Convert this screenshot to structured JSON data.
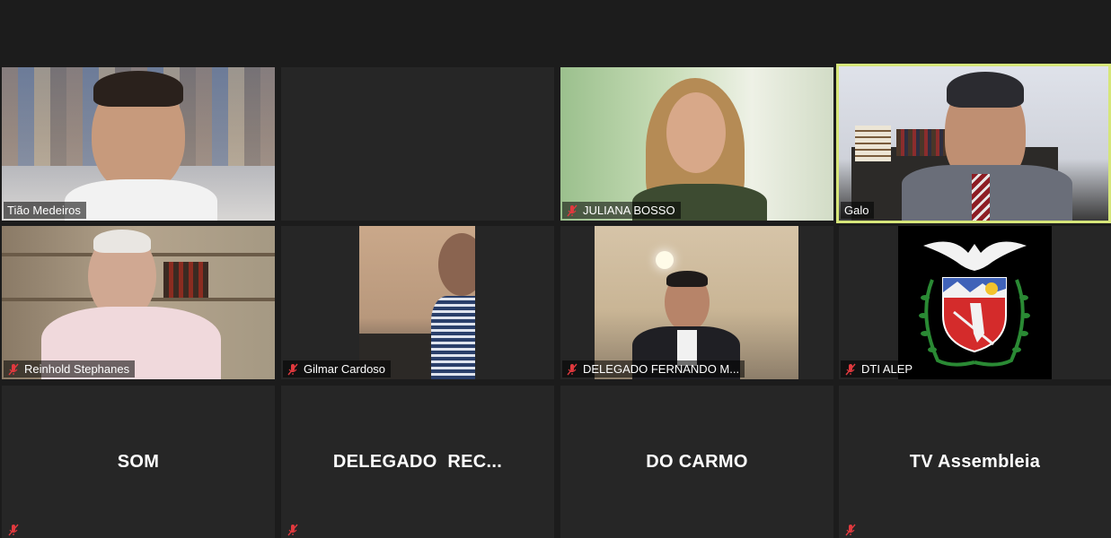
{
  "participants": [
    {
      "name": "Tião Medeiros",
      "muted": false,
      "video": true
    },
    {
      "name": "",
      "muted": false,
      "video": false
    },
    {
      "name": "JULIANA BOSSO",
      "muted": true,
      "video": true
    },
    {
      "name": "Galo",
      "muted": false,
      "video": true,
      "active_speaker": true
    },
    {
      "name": "Reinhold Stephanes",
      "muted": true,
      "video": true
    },
    {
      "name": "Gilmar Cardoso",
      "muted": true,
      "video": true
    },
    {
      "name": "DELEGADO FERNANDO M...",
      "muted": true,
      "video": true
    },
    {
      "name": "DTI ALEP",
      "muted": true,
      "video": true
    },
    {
      "name": "SOM",
      "muted": true,
      "video": false
    },
    {
      "name": "DELEGADO  REC...",
      "muted": true,
      "video": false
    },
    {
      "name": "DO CARMO",
      "muted": false,
      "video": false
    },
    {
      "name": "TV Assembleia",
      "muted": true,
      "video": false
    }
  ],
  "colors": {
    "background": "#1c1c1c",
    "tile": "#262626",
    "active_border": "#d6e67a",
    "muted_icon": "#e0393e"
  }
}
